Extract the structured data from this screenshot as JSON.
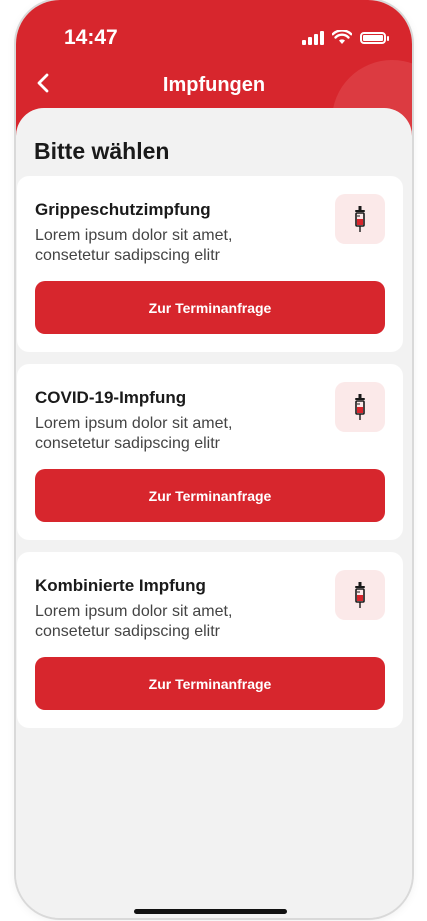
{
  "status_bar": {
    "time": "14:47"
  },
  "nav": {
    "title": "Impfungen",
    "back_icon": "chevron-left-icon"
  },
  "section_title": "Bitte wählen",
  "colors": {
    "primary": "#d7262d",
    "icon_bg": "#fbe9e9",
    "background": "#f2f2f2"
  },
  "cards": [
    {
      "title": "Grippeschutzimpfung",
      "description": "Lorem ipsum dolor sit amet, consetetur sadipscing elitr",
      "button_label": "Zur Terminanfrage",
      "icon": "syringe-icon"
    },
    {
      "title": "COVID-19-Impfung",
      "description": "Lorem ipsum dolor sit amet, consetetur sadipscing elitr",
      "button_label": "Zur Terminanfrage",
      "icon": "syringe-icon"
    },
    {
      "title": "Kombinierte Impfung",
      "description": "Lorem ipsum dolor sit amet, consetetur sadipscing elitr",
      "button_label": "Zur Terminanfrage",
      "icon": "syringe-icon"
    }
  ]
}
